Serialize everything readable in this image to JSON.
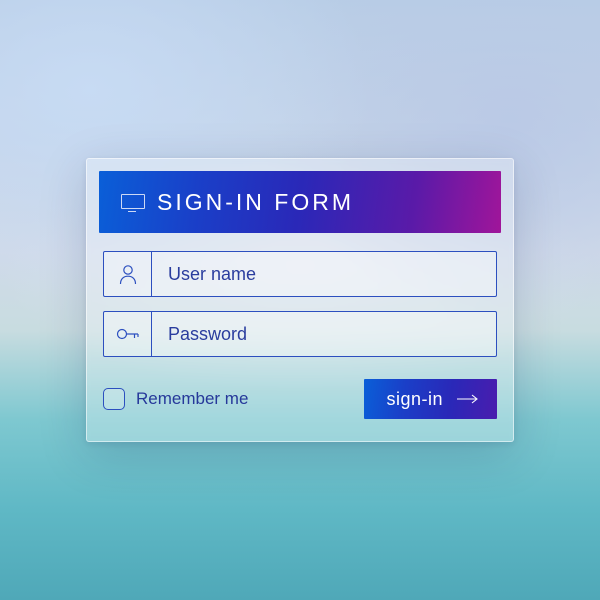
{
  "header": {
    "title": "SIGN-IN FORM",
    "icon": "monitor-icon"
  },
  "fields": {
    "username": {
      "placeholder": "User name",
      "value": "",
      "icon": "user-icon"
    },
    "password": {
      "placeholder": "Password",
      "value": "",
      "icon": "key-icon"
    }
  },
  "remember": {
    "label": "Remember me",
    "checked": false
  },
  "submit": {
    "label": "sign-in",
    "icon": "arrow-right-icon"
  },
  "colors": {
    "accent_start": "#0a5fd8",
    "accent_end": "#a0159a",
    "border": "#2c4fbf"
  }
}
